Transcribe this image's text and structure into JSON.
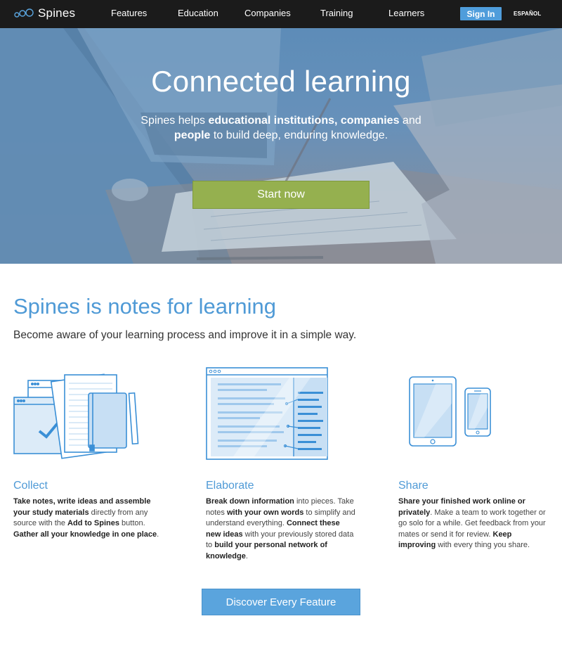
{
  "nav": {
    "brand": "Spines",
    "links": [
      "Features",
      "Education",
      "Companies",
      "Training",
      "Learners"
    ],
    "sign_in": "Sign In",
    "language": "ESPAÑOL"
  },
  "hero": {
    "title": "Connected learning",
    "subtitle": {
      "p1": "Spines helps ",
      "b1": "educational institutions, companies",
      "p2": " and ",
      "b2": "people",
      "p3": " to build deep, enduring knowledge."
    },
    "cta": "Start now"
  },
  "intro": {
    "title": "Spines is notes for learning",
    "subtitle": "Become aware of your learning process and improve it in a simple way."
  },
  "features": [
    {
      "title": "Collect",
      "icon": "collect-icon",
      "b1": "Take notes, write ideas and assemble your study materials",
      "p1": " directly from any source with the ",
      "b2": "Add to Spines",
      "p2": " button. ",
      "b3": "Gather all your knowledge in one place",
      "p3": "."
    },
    {
      "title": "Elaborate",
      "icon": "elaborate-icon",
      "b1": "Break down information",
      "p1": " into pieces. Take notes ",
      "b2": "with your own words",
      "p2": " to simplify and understand everything. ",
      "b3": "Connect these new ideas",
      "p3": " with your previously stored data to ",
      "b4": "build your personal network of knowledge",
      "p4": "."
    },
    {
      "title": "Share",
      "icon": "devices-icon",
      "b1": "Share your finished work online or privately",
      "p1": ". Make a team to work together or go solo for a while. Get feedback from your mates or send it for review. ",
      "b2": "Keep improving",
      "p2": " with every thing you share."
    }
  ],
  "discover": "Discover Every Feature",
  "colors": {
    "accent": "#4f9ad6",
    "nav_bg": "#1b1b1b",
    "cta_green": "#95b04f",
    "button_blue": "#5aa4dd"
  }
}
